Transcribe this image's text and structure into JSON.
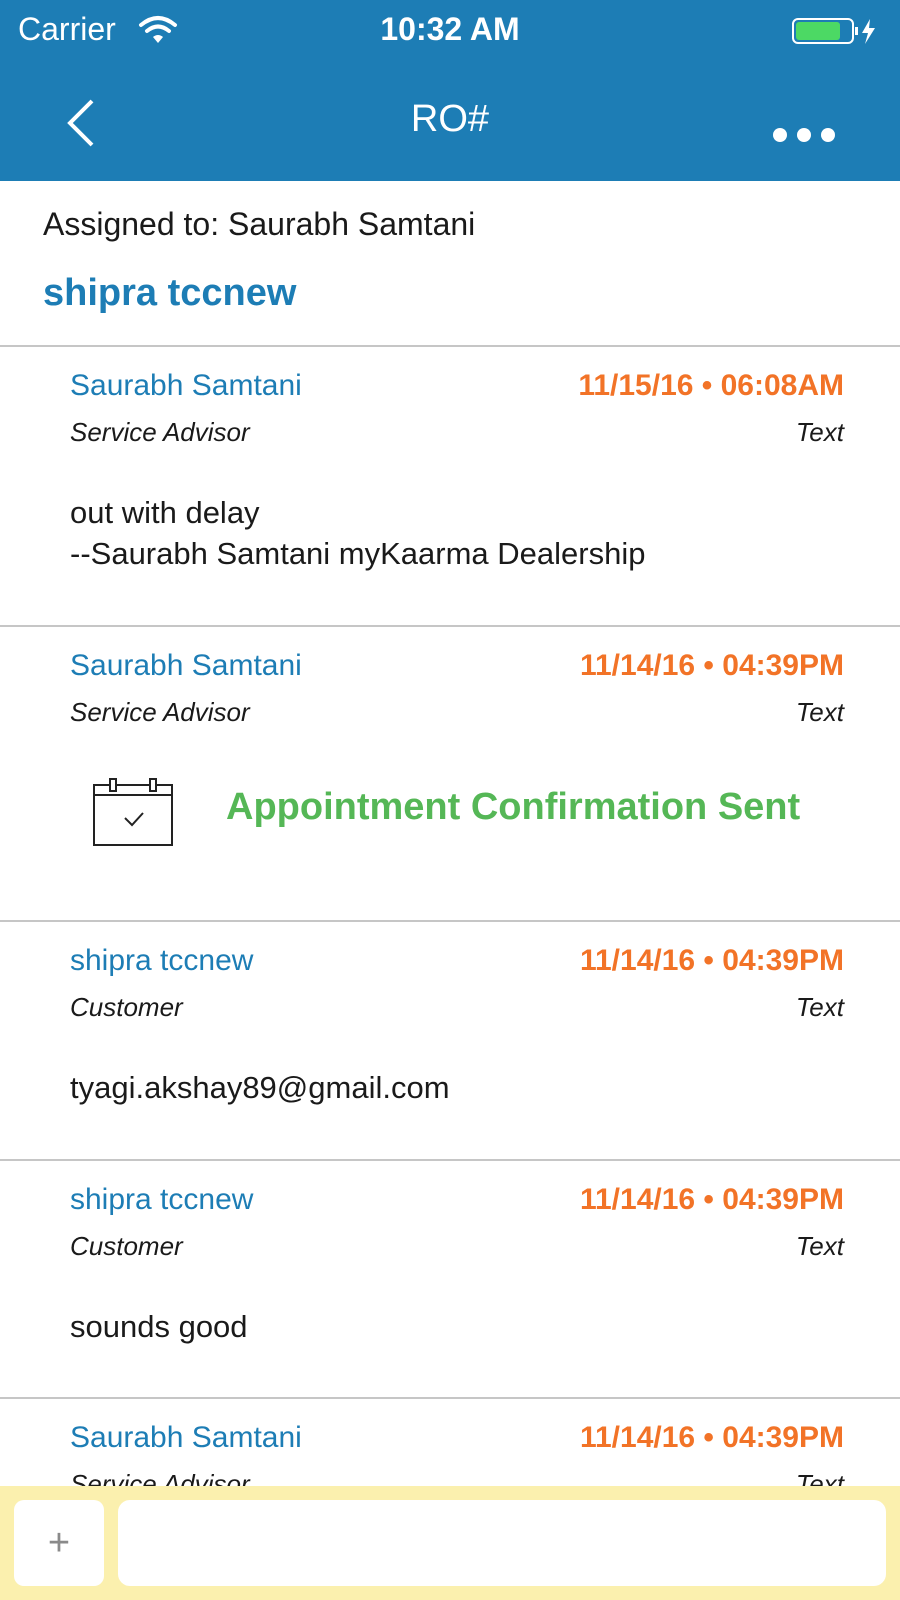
{
  "status_bar": {
    "carrier": "Carrier",
    "time": "10:32 AM",
    "icons": [
      "wifi-icon",
      "battery-charging-icon"
    ]
  },
  "nav": {
    "title": "RO#",
    "back_icon": "chevron-left-icon",
    "more_icon": "more-horizontal-icon"
  },
  "assignment": {
    "assigned_to": "Assigned to: Saurabh Samtani",
    "customer_name": "shipra tccnew"
  },
  "messages": [
    {
      "sender": "Saurabh Samtani",
      "timestamp": "11/15/16 • 06:08AM",
      "role": "Service Advisor",
      "type": "Text",
      "body": "out with delay\n--Saurabh Samtani myKaarma Dealership"
    },
    {
      "sender": "Saurabh Samtani",
      "timestamp": "11/14/16 • 04:39PM",
      "role": "Service Advisor",
      "type": "Text",
      "event_icon": "calendar-check-icon",
      "event": "Appointment Confirmation Sent"
    },
    {
      "sender": "shipra tccnew",
      "timestamp": "11/14/16 • 04:39PM",
      "role": "Customer",
      "type": "Text",
      "body": "tyagi.akshay89@gmail.com"
    },
    {
      "sender": "shipra tccnew",
      "timestamp": "11/14/16 • 04:39PM",
      "role": "Customer",
      "type": "Text",
      "body": "sounds good"
    },
    {
      "sender": "Saurabh Samtani",
      "timestamp": "11/14/16 • 04:39PM",
      "role": "Service Advisor",
      "type": "Text"
    }
  ],
  "composer": {
    "add_label": "+",
    "input_value": "",
    "input_placeholder": ""
  },
  "colors": {
    "header": "#1d7db5",
    "link_blue": "#1d7db5",
    "timestamp_orange": "#f27327",
    "event_green": "#55b756",
    "composer_bg": "#fbf0ae",
    "divider": "#c6c6c6"
  }
}
